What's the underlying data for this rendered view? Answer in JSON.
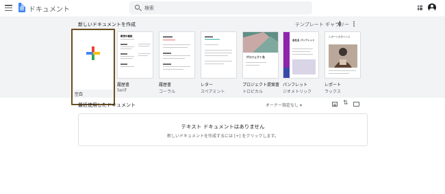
{
  "header": {
    "app_title": "ドキュメント",
    "search_placeholder": "検索"
  },
  "gallery": {
    "new_doc_label": "新しいドキュメントを作成",
    "toggle_label": "テンプレート ギャラリー",
    "templates": [
      {
        "name": "空白",
        "sub": ""
      },
      {
        "name": "履歴書",
        "sub": "Serif"
      },
      {
        "name": "履歴書",
        "sub": "コーラル"
      },
      {
        "name": "レター",
        "sub": "スペアミント"
      },
      {
        "name": "プロジェクト提案書",
        "sub": "トロピカル"
      },
      {
        "name": "パンフレット",
        "sub": "ジオメトリック"
      },
      {
        "name": "レポート",
        "sub": "ラックス"
      }
    ],
    "thumb_texts": {
      "resume_serif": "新田の看板",
      "project_title": "プロジェクト名",
      "brochure_title": "会社名 パンフレット",
      "report_title": "レポートのタイトル"
    }
  },
  "recent": {
    "title": "最近使用したドキュメント",
    "owner_filter": "オーナー指定なし",
    "empty_title": "テキスト ドキュメントはありません",
    "empty_hint": "新しいドキュメントを作成するには [+] をクリックします。"
  },
  "colors": {
    "accent": "#4285f4",
    "gallery_bg": "#f1f3f4",
    "blank_highlight": "#6b4f1d"
  }
}
